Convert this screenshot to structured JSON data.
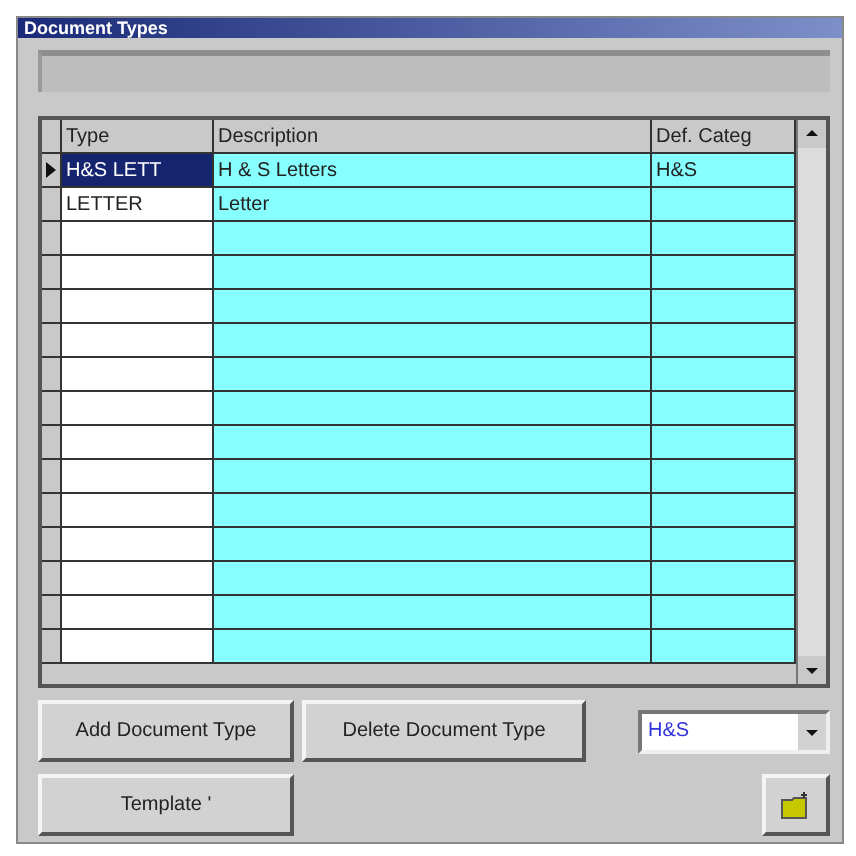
{
  "window": {
    "title": "Document Types"
  },
  "grid": {
    "columns": [
      "Type",
      "Description",
      "Def. Categ"
    ],
    "rows": [
      {
        "type": "H&S LETT",
        "description": "H & S Letters",
        "category": "H&S",
        "selected": true
      },
      {
        "type": "LETTER",
        "description": "Letter",
        "category": "",
        "selected": false
      }
    ]
  },
  "buttons": {
    "add": "Add Document Type",
    "delete": "Delete Document Type",
    "template": "Template '"
  },
  "category_select": {
    "value": "H&S"
  }
}
